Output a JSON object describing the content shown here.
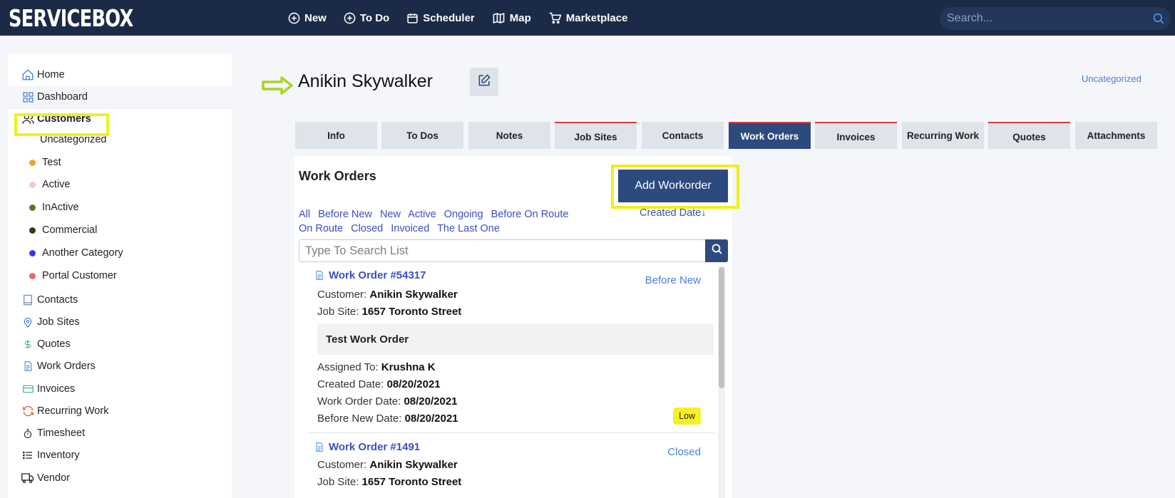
{
  "app": {
    "logo": "SERVICEBOX"
  },
  "topnav": [
    {
      "label": "New",
      "icon": "plus-circle-icon"
    },
    {
      "label": "To Do",
      "icon": "plus-circle-icon"
    },
    {
      "label": "Scheduler",
      "icon": "calendar-icon"
    },
    {
      "label": "Map",
      "icon": "map-icon"
    },
    {
      "label": "Marketplace",
      "icon": "cart-icon"
    }
  ],
  "search": {
    "placeholder": "Search..."
  },
  "sidebar": {
    "items": [
      {
        "label": "Home",
        "icon": "home-icon"
      },
      {
        "label": "Dashboard",
        "icon": "grid-icon"
      },
      {
        "label": "Customers",
        "icon": "users-icon"
      },
      {
        "label": "Uncategorized"
      },
      {
        "label": "Test",
        "color": "#f0a531"
      },
      {
        "label": "Active",
        "color": "#f3c9c8"
      },
      {
        "label": "InActive",
        "color": "#6b7020"
      },
      {
        "label": "Commercial",
        "color": "#3a3a16"
      },
      {
        "label": "Another Category",
        "color": "#3a37e6"
      },
      {
        "label": "Portal Customer",
        "color": "#e86a6a"
      },
      {
        "label": "Contacts",
        "icon": "book-icon"
      },
      {
        "label": "Job Sites",
        "icon": "map-pin-icon"
      },
      {
        "label": "Quotes",
        "icon": "dollar-icon"
      },
      {
        "label": "Work Orders",
        "icon": "document-icon"
      },
      {
        "label": "Invoices",
        "icon": "credit-card-icon"
      },
      {
        "label": "Recurring Work",
        "icon": "refresh-icon"
      },
      {
        "label": "Timesheet",
        "icon": "stopwatch-icon"
      },
      {
        "label": "Inventory",
        "icon": "list-icon"
      },
      {
        "label": "Vendor",
        "icon": "truck-icon"
      }
    ]
  },
  "page": {
    "title": "Anikin Skywalker",
    "category": "Uncategorized"
  },
  "tabs": [
    {
      "label": "Info"
    },
    {
      "label": "To Dos"
    },
    {
      "label": "Notes"
    },
    {
      "label": "Job Sites"
    },
    {
      "label": "Contacts"
    },
    {
      "label": "Work Orders"
    },
    {
      "label": "Invoices"
    },
    {
      "label": "Recurring Work"
    },
    {
      "label": "Quotes"
    },
    {
      "label": "Attachments"
    }
  ],
  "work_orders": {
    "title": "Work Orders",
    "add_button": "Add Workorder",
    "filters": [
      "All",
      "Before New",
      "New",
      "Active",
      "Ongoing",
      "Before On Route",
      "On Route",
      "Closed",
      "Invoiced",
      "The Last One"
    ],
    "sort_label": "Created Date",
    "sort_arrow": "↓",
    "search_placeholder": "Type To Search List",
    "labels": {
      "customer": "Customer:",
      "job_site": "Job Site:",
      "assigned_to": "Assigned To:",
      "created_date": "Created Date:",
      "work_order_date": "Work Order Date:",
      "before_new_date": "Before New Date:"
    },
    "items": [
      {
        "title": "Work Order #54317",
        "status": "Before New",
        "customer": "Anikin Skywalker",
        "job_site": "1657 Toronto Street",
        "description": "Test Work Order",
        "assigned_to": "Krushna K",
        "created_date": "08/20/2021",
        "work_order_date": "08/20/2021",
        "before_new_date": "08/20/2021",
        "priority": "Low"
      },
      {
        "title": "Work Order #1491",
        "status": "Closed",
        "customer": "Anikin Skywalker",
        "job_site": "1657 Toronto Street"
      }
    ]
  }
}
